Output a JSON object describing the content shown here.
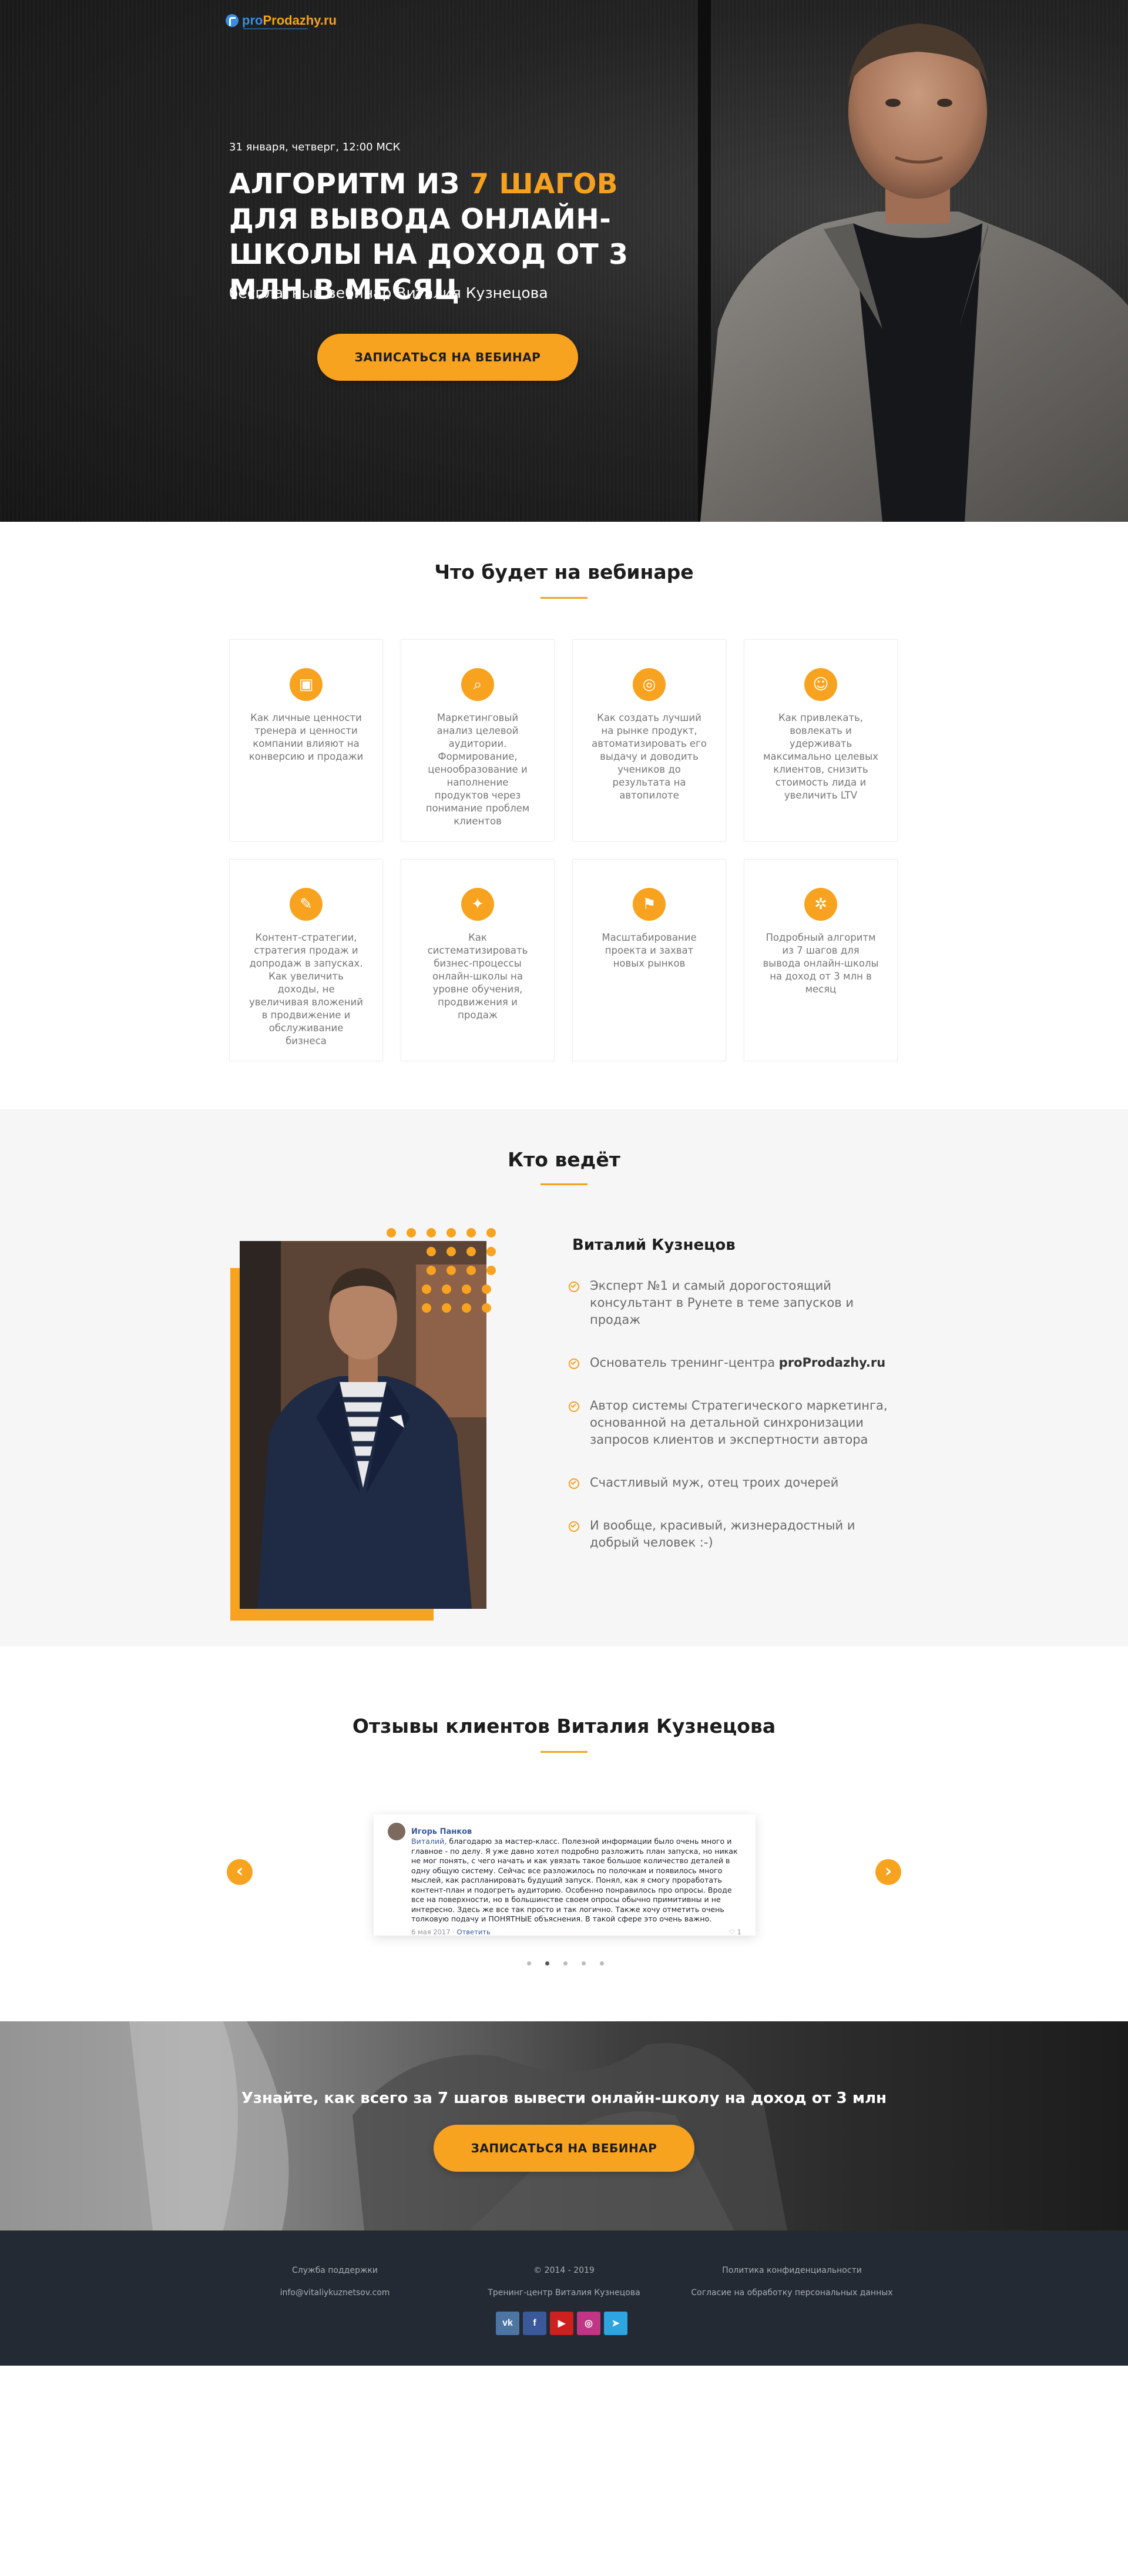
{
  "hero": {
    "logo_text_a": "pro",
    "logo_text_b": "Prodazhy.ru",
    "date": "31 января, четверг, 12:00 МСК",
    "title_before": "Алгоритм из ",
    "title_highlight": "7 шагов",
    "title_after": " для вывода онлайн-школы на доход от 3 млн в месяц",
    "subtitle": "бесплатный вебинар Виталия Кузнецова",
    "cta_label": "Записаться на вебинар"
  },
  "webinar": {
    "title": "Что будет на вебинаре",
    "items": [
      {
        "icon": "presentation-icon",
        "text": "Как личные ценности тренера и ценности компании влияют на конверсию и продажи"
      },
      {
        "icon": "magnifier-analytics-icon",
        "text": "Маркетинговый анализ целевой аудитории. Формирование, ценообразование и наполнение продуктов через понимание проблем клиентов"
      },
      {
        "icon": "target-icon",
        "text": "Как создать лучший на рынке продукт, автоматизировать его выдачу и доводить учеников до результата на автопилоте"
      },
      {
        "icon": "customers-icon",
        "text": "Как привлекать, вовлекать и удерживать максимально целевых клиентов, снизить стоимость лида и увеличить LTV"
      },
      {
        "icon": "content-strategy-icon",
        "text": "Контент-стратегии, стратегия продаж и допродаж в запусках. Как увеличить доходы, не увеличивая вложений в продвижение и обслуживание бизнеса"
      },
      {
        "icon": "lightbulb-icon",
        "text": "Как систематизировать бизнес-процессы онлайн-школы на уровне обучения, продвижения и продаж"
      },
      {
        "icon": "flag-icon",
        "text": "Масштабирование проекта и захват новых рынков"
      },
      {
        "icon": "algorithm-icon",
        "text": "Подробный алгоритм из 7 шагов для вывода онлайн-школы на доход от 3 млн в месяц"
      }
    ]
  },
  "host": {
    "title": "Кто ведёт",
    "name": "Виталий Кузнецов",
    "facts": [
      {
        "text": "Эксперт №1 и самый дорогостоящий консультант в Рунете в теме запусков и продаж",
        "bold": ""
      },
      {
        "text": "Основатель тренинг-центра ",
        "bold": "proProdazhy.ru"
      },
      {
        "text": "Автор системы Стратегического маркетинга, основанной на детальной синхронизации запросов клиентов и экспертности автора",
        "bold": ""
      },
      {
        "text": "Счастливый муж, отец троих дочерей",
        "bold": ""
      },
      {
        "text": "И вообще, красивый, жизнерадостный и добрый человек :-)",
        "bold": ""
      }
    ]
  },
  "reviews": {
    "title": "Отзывы клиентов Виталия Кузнецова",
    "card": {
      "author": "Игорь Панков",
      "mention": "Виталий,",
      "text": " благодарю за мастер-класс. Полезной информации было очень много и главное - по делу. Я уже давно хотел подробно разложить план запуска, но никак не мог понять, с чего начать и как увязать такое большое количество деталей в одну общую систему. Сейчас все разложилось по полочкам и появилось много мыслей, как распланировать будущий запуск. Понял, как я смогу проработать контент-план и подогреть аудиторию. Особенно понравилось про опросы. Вроде все на поверхности, но в большинстве своем опросы обычно примитивны и не интересно. Здесь же все так просто и так логично. Также хочу отметить очень толковую подачу и ПОНЯТНЫЕ объяснения. В такой сфере это очень важно.",
      "date": "6 мая 2017",
      "reply": "Ответить",
      "likes": "♡ 1"
    },
    "prev": "‹",
    "next": "›",
    "page_count": 5,
    "active_page": 2
  },
  "cta": {
    "title": "Узнайте, как всего за 7 шагов вывести онлайн-школу на доход от 3 млн",
    "button": "Записаться на вебинар"
  },
  "footer": {
    "support_title": "Служба поддержки",
    "support_email": "info@vitaliykuznetsov.com",
    "copyright": "© 2014 - 2019",
    "company": "Тренинг-центр Виталия Кузнецова",
    "privacy": "Политика конфиденциальности",
    "consent": "Согласие на обработку персональных данных",
    "socials": [
      {
        "icon": "vk-icon",
        "glyph": "vk",
        "color": "#4c75a3"
      },
      {
        "icon": "facebook-icon",
        "glyph": "f",
        "color": "#3b5998"
      },
      {
        "icon": "youtube-icon",
        "glyph": "▶",
        "color": "#cd201f"
      },
      {
        "icon": "instagram-icon",
        "glyph": "◎",
        "color": "#c13584"
      },
      {
        "icon": "telegram-icon",
        "glyph": "➤",
        "color": "#2ca5e0"
      }
    ]
  },
  "colors": {
    "accent": "#f8a31f",
    "footer_bg": "#242a33",
    "link": "#365899"
  }
}
